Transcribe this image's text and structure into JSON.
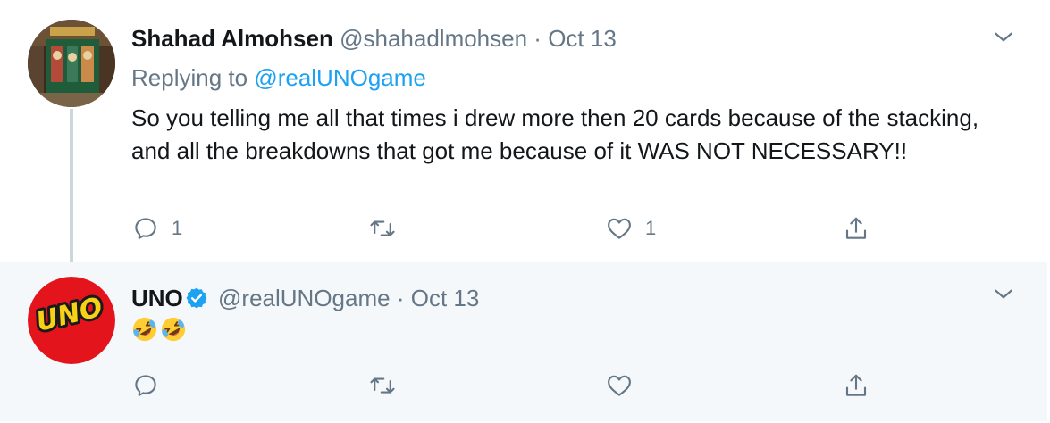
{
  "tweets": [
    {
      "name": "Shahad Almohsen",
      "handle": "@shahadlmohsen",
      "separator": "·",
      "date": "Oct 13",
      "replying_prefix": "Replying to ",
      "replying_to": "@realUNOgame",
      "text": "So you telling me all that times i drew more then 20 cards because of the stacking, and all the breakdowns that got me because of it WAS NOT NECESSARY!!",
      "reply_count": "1",
      "retweet_count": "",
      "like_count": "1",
      "avatar_icon": "avatar-photo-gelateria"
    },
    {
      "name": "UNO",
      "verified": true,
      "handle": "@realUNOgame",
      "separator": "·",
      "date": "Oct 13",
      "emojis": [
        "rolling-on-floor-laughing-emoji",
        "rolling-on-floor-laughing-emoji"
      ],
      "avatar_logo_text": "UNO",
      "reply_count": "",
      "retweet_count": "",
      "like_count": ""
    }
  ],
  "colors": {
    "accent": "#1da1f2",
    "muted": "#657786",
    "text": "#14171a",
    "thread_line": "#ccd6dd",
    "reply_bg": "#f5f8fa",
    "uno_red": "#e3141b",
    "uno_yellow": "#f7d117"
  }
}
